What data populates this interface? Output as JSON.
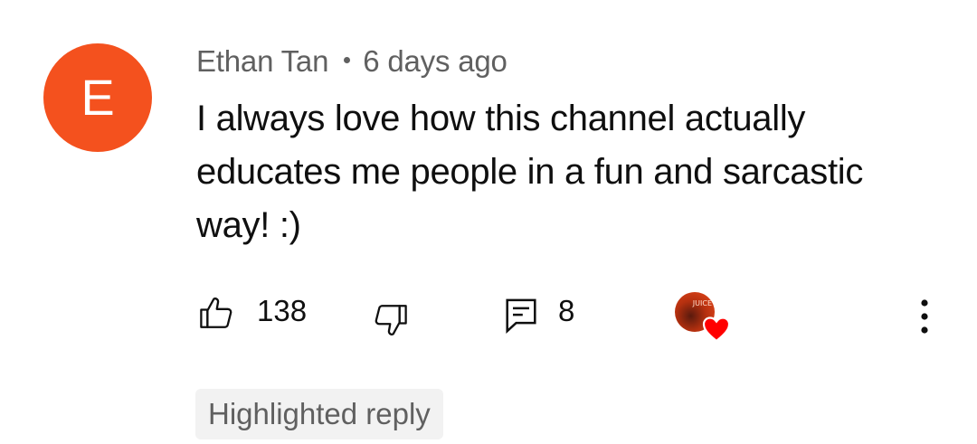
{
  "comment": {
    "avatar_letter": "E",
    "avatar_color": "#f4511e",
    "author": "Ethan Tan",
    "time_ago": "6 days ago",
    "text": "I always love how this channel actually educates me people in a fun and sarcastic way! :)"
  },
  "actions": {
    "like_icon": "thumbs-up-icon",
    "like_count": "138",
    "dislike_icon": "thumbs-down-icon",
    "reply_icon": "comment-icon",
    "reply_count": "8",
    "creator_heart_icon": "heart-icon",
    "creator_avatar_text": "JUICE",
    "heart_color": "#ff0000",
    "more_icon": "more-vertical-icon"
  },
  "highlight": {
    "label": "Highlighted reply"
  }
}
